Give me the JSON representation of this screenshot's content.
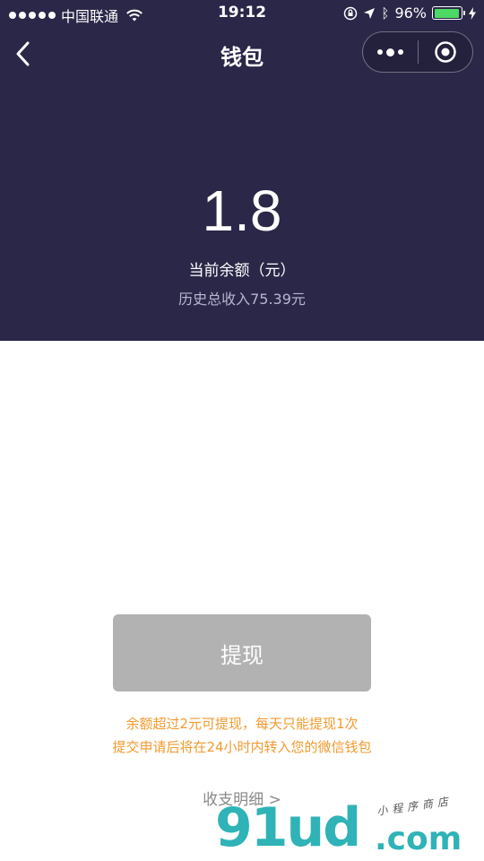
{
  "status_bar": {
    "carrier": "中国联通",
    "time": "19:12",
    "battery_percent": "96%",
    "battery_level": 0.96,
    "battery_color": "#4cd964"
  },
  "nav": {
    "title": "钱包",
    "back_icon": "chevron-left-icon",
    "more_icon": "more-dots-icon",
    "close_icon": "target-close-icon"
  },
  "wallet": {
    "balance": "1.8",
    "balance_label": "当前余额（元）",
    "history_income": "历史总收入75.39元"
  },
  "actions": {
    "withdraw_label": "提现",
    "notice_line1": "余额超过2元可提现，每天只能提现1次",
    "notice_line2": "提交申请后将在24小时内转入您的微信钱包",
    "details_label": "收支明细 >"
  },
  "colors": {
    "header_bg": "#2b2748",
    "button_bg": "#b2b2b2",
    "notice_text": "#f29a2e",
    "watermark": "#2fb3b7"
  },
  "watermark": {
    "logo": "91ud",
    "domain": ".com",
    "tagline": "小程序商店"
  }
}
